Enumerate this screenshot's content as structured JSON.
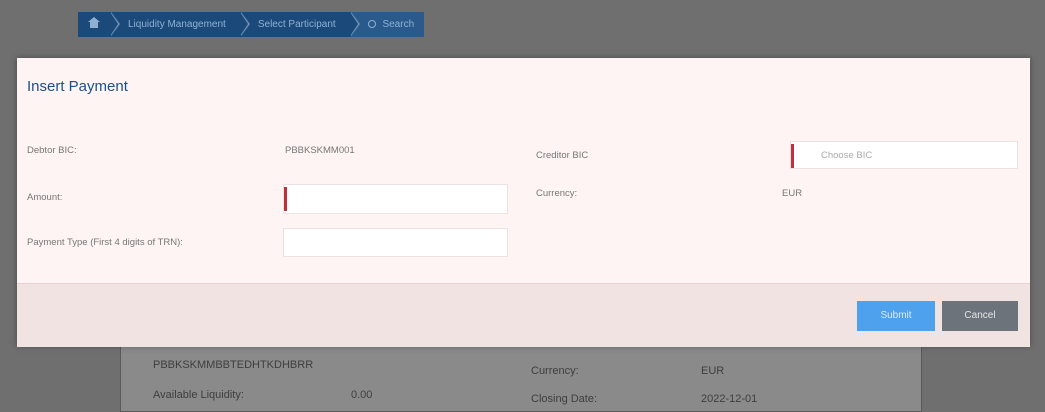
{
  "breadcrumb": {
    "items": [
      {
        "label": "Liquidity Management"
      },
      {
        "label": "Select Participant"
      },
      {
        "label": "Search"
      }
    ]
  },
  "background": {
    "account": "PBBKSKMMBBTEDHTKDHBRR",
    "available_liquidity_label": "Available Liquidity:",
    "available_liquidity_value": "0.00",
    "currency_label": "Currency:",
    "currency_value": "EUR",
    "date_label": "Closing Date:",
    "date_value": "2022-12-01"
  },
  "modal": {
    "title": "Insert Payment",
    "debtor_bic_label": "Debtor BIC:",
    "debtor_bic_value": "PBBKSKMM001",
    "creditor_bic_label": "Creditor BIC",
    "creditor_bic_placeholder": "Choose BIC",
    "amount_label": "Amount:",
    "amount_value": "",
    "currency_label": "Currency:",
    "currency_value": "EUR",
    "payment_type_label": "Payment Type (First 4 digits of TRN):",
    "payment_type_value": "",
    "submit_label": "Submit",
    "cancel_label": "Cancel"
  },
  "colors": {
    "accent_blue": "#4ea1ec",
    "required_marker": "#c0303a",
    "title_blue": "#1d4f8a"
  }
}
